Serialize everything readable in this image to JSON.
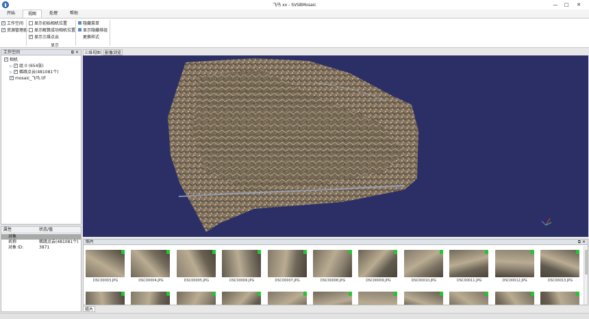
{
  "window": {
    "title": "飞马 xx - SVSBMosaic",
    "minimize": "—",
    "maximize": "□",
    "close": "✕"
  },
  "menu": {
    "tabs": [
      "开始",
      "视图",
      "处理",
      "帮助"
    ],
    "active_index": 1
  },
  "ribbon": {
    "workspace_check": "工作空间",
    "resource_check": "资源管理器",
    "display_group": {
      "label": "显示",
      "items": [
        "显示初始相机位置",
        "显示解算成功相机位置",
        "显示三维点云"
      ],
      "checked": [
        false,
        false,
        true
      ]
    },
    "commands": [
      "隐藏菜单",
      "显示隐藏排组",
      "更换样式"
    ]
  },
  "workspace_panel": {
    "title": "工作空间",
    "tree": {
      "root": "相机",
      "group": "组 0 (654张)",
      "pointcloud": "稀疏点云(481081个)",
      "mosaic": "mosaic_飞马.tif"
    }
  },
  "properties": {
    "col_attr": "属性",
    "col_value": "状态/值",
    "section": "对象",
    "rows": [
      {
        "key": "名称",
        "value": "稀疏点云(481081个)"
      },
      {
        "key": "对象 ID:",
        "value": "3871"
      }
    ]
  },
  "view_tabs": [
    "三维视图",
    "影像浏览"
  ],
  "photos_panel": {
    "title": "照片",
    "bottom_tab": "照片",
    "row1": [
      "DSC00003.JPG",
      "DSC00004.JPG",
      "DSC00005.JPG",
      "DSC00006.JPG",
      "DSC00007.JPG",
      "DSC00008.JPG",
      "DSC00009.JPG",
      "DSC00010.JPG",
      "DSC00011.JPG",
      "DSC00012.JPG",
      "DSC00013.JPG"
    ],
    "row2_count": 11
  },
  "colors": {
    "viewport_bg": "#2b2f66",
    "status_mark": "#22c532",
    "accent": "#3a78c9"
  }
}
